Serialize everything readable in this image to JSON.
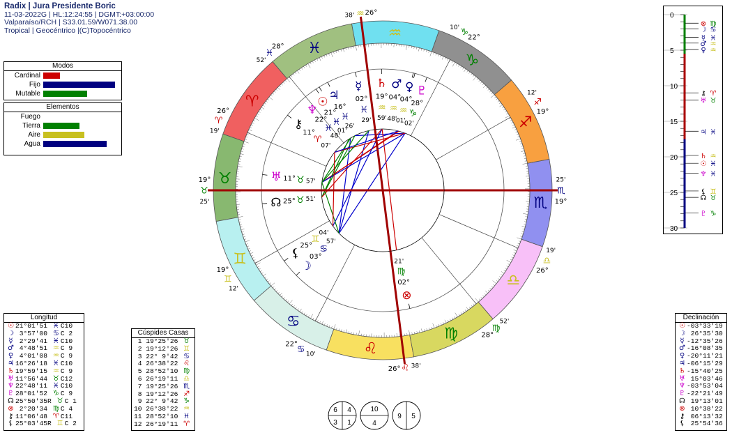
{
  "header": {
    "title": "Radix | Jura Presidente Boric",
    "line1": "11-03-2022G | HL:12:24:55 | DGMT:+03:00:00",
    "line2": "Valparaíso/RCH | S33.01.59/W071.38.00",
    "line3": "Tropical | Geocéntrico |(C)Topocéntrico"
  },
  "modos": {
    "title": "Modos",
    "rows": [
      {
        "label": "Cardinal",
        "value": 0.22,
        "color": "#cc0000"
      },
      {
        "label": "Fijo",
        "value": 0.95,
        "color": "#000080"
      },
      {
        "label": "Mutable",
        "value": 0.58,
        "color": "#008000"
      }
    ]
  },
  "elementos": {
    "title": "Elementos",
    "rows": [
      {
        "label": "Fuego",
        "value": 0.0,
        "color": "#cc0000"
      },
      {
        "label": "Tierra",
        "value": 0.48,
        "color": "#008000"
      },
      {
        "label": "Aire",
        "value": 0.55,
        "color": "#c8c020"
      },
      {
        "label": "Agua",
        "value": 0.84,
        "color": "#000080"
      }
    ]
  },
  "longitud": {
    "title": "Longitud",
    "rows": [
      {
        "g": "☉",
        "c": "#cc0000",
        "deg": "21°01'51",
        "s": "♓",
        "sc": "#000080",
        "h": "C10"
      },
      {
        "g": "☽",
        "c": "#000080",
        "deg": " 3°57'00",
        "s": "♋",
        "sc": "#000080",
        "h": "C 2"
      },
      {
        "g": "☿",
        "c": "#000080",
        "deg": " 2°29'41",
        "s": "♓",
        "sc": "#000080",
        "h": "C10"
      },
      {
        "g": "♂",
        "c": "#000080",
        "deg": " 4°48'51",
        "s": "♒",
        "sc": "#c8c020",
        "h": "C 9"
      },
      {
        "g": "♀",
        "c": "#000080",
        "deg": " 4°01'08",
        "s": "♒",
        "sc": "#c8c020",
        "h": "C 9"
      },
      {
        "g": "♃",
        "c": "#000080",
        "deg": "16°26'18",
        "s": "♓",
        "sc": "#000080",
        "h": "C10"
      },
      {
        "g": "♄",
        "c": "#cc0000",
        "deg": "19°59'15",
        "s": "♒",
        "sc": "#c8c020",
        "h": "C 9"
      },
      {
        "g": "♅",
        "c": "#cc00cc",
        "deg": "11°56'44",
        "s": "♉",
        "sc": "#008000",
        "h": "C12"
      },
      {
        "g": "♆",
        "c": "#cc00cc",
        "deg": "22°48'11",
        "s": "♓",
        "sc": "#000080",
        "h": "C10"
      },
      {
        "g": "♇",
        "c": "#cc00cc",
        "deg": "28°01'52",
        "s": "♑",
        "sc": "#008000",
        "h": "C 9"
      },
      {
        "g": "☊",
        "c": "#000000",
        "deg": "25°50'35R",
        "s": "♉",
        "sc": "#008000",
        "h": "C 1"
      },
      {
        "g": "⊗",
        "c": "#cc0000",
        "deg": " 2°20'34",
        "s": "♍",
        "sc": "#008000",
        "h": "C 4"
      },
      {
        "g": "⚷",
        "c": "#000000",
        "deg": "11°06'48",
        "s": "♈",
        "sc": "#cc0000",
        "h": "C11"
      },
      {
        "g": "⚸",
        "c": "#000000",
        "deg": "25°03'45R",
        "s": "♊",
        "sc": "#c8c020",
        "h": "C 2"
      }
    ]
  },
  "cuspides": {
    "title": "Cúspides Casas",
    "rows": [
      {
        "n": " 1",
        "deg": "19°25'26",
        "s": "♉",
        "sc": "#008000"
      },
      {
        "n": " 2",
        "deg": "19°12'26",
        "s": "♊",
        "sc": "#c8c020"
      },
      {
        "n": " 3",
        "deg": "22° 9'42",
        "s": "♋",
        "sc": "#000080"
      },
      {
        "n": " 4",
        "deg": "26°38'22",
        "s": "♌",
        "sc": "#cc0000"
      },
      {
        "n": " 5",
        "deg": "28°52'10",
        "s": "♍",
        "sc": "#008000"
      },
      {
        "n": " 6",
        "deg": "26°19'11",
        "s": "♎",
        "sc": "#c8c020"
      },
      {
        "n": " 7",
        "deg": "19°25'26",
        "s": "♏",
        "sc": "#000080"
      },
      {
        "n": " 8",
        "deg": "19°12'26",
        "s": "♐",
        "sc": "#cc0000"
      },
      {
        "n": " 9",
        "deg": "22° 9'42",
        "s": "♑",
        "sc": "#008000"
      },
      {
        "n": "10",
        "deg": "26°38'22",
        "s": "♒",
        "sc": "#c8c020"
      },
      {
        "n": "11",
        "deg": "28°52'10",
        "s": "♓",
        "sc": "#000080"
      },
      {
        "n": "12",
        "deg": "26°19'11",
        "s": "♈",
        "sc": "#cc0000"
      }
    ]
  },
  "declinacion": {
    "title": "Declinación",
    "rows": [
      {
        "g": "☉",
        "c": "#cc0000",
        "v": "-03°33'19"
      },
      {
        "g": "☽",
        "c": "#000080",
        "v": " 26°35'30"
      },
      {
        "g": "☿",
        "c": "#000080",
        "v": "-12°35'26"
      },
      {
        "g": "♂",
        "c": "#000080",
        "v": "-16°08'35"
      },
      {
        "g": "♀",
        "c": "#000080",
        "v": "-20°11'21"
      },
      {
        "g": "♃",
        "c": "#000080",
        "v": "-06°15'29"
      },
      {
        "g": "♄",
        "c": "#cc0000",
        "v": "-15°40'25"
      },
      {
        "g": "♅",
        "c": "#cc00cc",
        "v": " 15°03'46"
      },
      {
        "g": "♆",
        "c": "#cc00cc",
        "v": "-03°53'04"
      },
      {
        "g": "♇",
        "c": "#cc00cc",
        "v": "-22°21'49"
      },
      {
        "g": "☊",
        "c": "#000000",
        "v": " 19°13'01"
      },
      {
        "g": "⊗",
        "c": "#cc0000",
        "v": " 10°38'22"
      },
      {
        "g": "⚷",
        "c": "#000000",
        "v": " 06°13'32"
      },
      {
        "g": "⚸",
        "c": "#000000",
        "v": " 25°54'36"
      }
    ]
  },
  "decl_scale": {
    "ticks": [
      "0",
      "5",
      "10",
      "15",
      "20",
      "25",
      "30"
    ],
    "max": 30,
    "marks": [
      {
        "d": 1.2,
        "g": "⊗",
        "c": "#cc0000",
        "s": "♍",
        "sc": "#008000"
      },
      {
        "d": 2.0,
        "g": "☽",
        "c": "#000080",
        "s": "♋",
        "sc": "#000080"
      },
      {
        "d": 3.2,
        "g": "☿",
        "c": "#000080",
        "s": "♓",
        "sc": "#000080"
      },
      {
        "d": 4.0,
        "g": "♂",
        "c": "#000080",
        "s": "♒",
        "sc": "#c8c020"
      },
      {
        "d": 4.9,
        "g": "♀",
        "c": "#000080",
        "s": "♒",
        "sc": "#c8c020"
      },
      {
        "d": 11.0,
        "g": "⚷",
        "c": "#000000",
        "s": "♈",
        "sc": "#cc0000"
      },
      {
        "d": 12.0,
        "g": "♅",
        "c": "#cc00cc",
        "s": "♉",
        "sc": "#008000"
      },
      {
        "d": 16.4,
        "g": "♃",
        "c": "#000080",
        "s": "♓",
        "sc": "#000080"
      },
      {
        "d": 19.8,
        "g": "♄",
        "c": "#cc0000",
        "s": "♒",
        "sc": "#c8c020"
      },
      {
        "d": 20.9,
        "g": "☉",
        "c": "#cc0000",
        "s": "♓",
        "sc": "#000080"
      },
      {
        "d": 22.3,
        "g": "♆",
        "c": "#cc00cc",
        "s": "♓",
        "sc": "#000080"
      },
      {
        "d": 24.8,
        "g": "⚸",
        "c": "#000000",
        "s": "♊",
        "sc": "#c8c020"
      },
      {
        "d": 25.7,
        "g": "☊",
        "c": "#000000",
        "s": "♉",
        "sc": "#008000"
      },
      {
        "d": 27.9,
        "g": "♇",
        "c": "#cc00cc",
        "s": "♑",
        "sc": "#008000"
      }
    ]
  },
  "wheel": {
    "asc": 49.42,
    "sign_glyphs": [
      "♈",
      "♉",
      "♊",
      "♋",
      "♌",
      "♍",
      "♎",
      "♏",
      "♐",
      "♑",
      "♒",
      "♓"
    ],
    "sign_fill": [
      "#f06060",
      "#88b870",
      "#b8f0f0",
      "#d8f0e8",
      "#f8e060",
      "#d8d860",
      "#f8c0f8",
      "#9090f0",
      "#f8a040",
      "#909090",
      "#70e0f0",
      "#a0c080"
    ],
    "sign_glyph_color": [
      "#cc0000",
      "#008000",
      "#c8c020",
      "#000080",
      "#cc0000",
      "#008000",
      "#c8c020",
      "#000080",
      "#cc0000",
      "#008000",
      "#c8c020",
      "#000080"
    ],
    "cusps": [
      {
        "n": 1,
        "lon": 49.42,
        "deg": "19°",
        "sign": "♉",
        "min": "25'",
        "c": "#008000"
      },
      {
        "n": 2,
        "lon": 79.21,
        "deg": "19°",
        "sign": "♊",
        "min": "12'",
        "c": "#c8c020"
      },
      {
        "n": 3,
        "lon": 112.16,
        "deg": "22°",
        "sign": "♋",
        "min": "10'",
        "c": "#000080"
      },
      {
        "n": 4,
        "lon": 146.64,
        "deg": "26°",
        "sign": "♌",
        "min": "38'",
        "c": "#cc0000"
      },
      {
        "n": 5,
        "lon": 178.87,
        "deg": "28°",
        "sign": "♍",
        "min": "52'",
        "c": "#008000"
      },
      {
        "n": 6,
        "lon": 206.32,
        "deg": "26°",
        "sign": "♎",
        "min": "19'",
        "c": "#c8c020"
      },
      {
        "n": 7,
        "lon": 229.42,
        "deg": "19°",
        "sign": "♏",
        "min": "25'",
        "c": "#000080"
      },
      {
        "n": 8,
        "lon": 259.21,
        "deg": "19°",
        "sign": "♐",
        "min": "12'",
        "c": "#cc0000"
      },
      {
        "n": 9,
        "lon": 292.16,
        "deg": "22°",
        "sign": "♑",
        "min": "10'",
        "c": "#008000"
      },
      {
        "n": 10,
        "lon": 326.64,
        "deg": "26°",
        "sign": "♒",
        "min": "38'",
        "c": "#c8c020"
      },
      {
        "n": 11,
        "lon": 358.87,
        "deg": "28°",
        "sign": "♓",
        "min": "52'",
        "c": "#000080"
      },
      {
        "n": 12,
        "lon": 26.32,
        "deg": "26°",
        "sign": "♈",
        "min": "19'",
        "c": "#cc0000"
      }
    ],
    "planets": [
      {
        "g": "☉",
        "c": "#cc0000",
        "lon": 351.03,
        "deg": "21°",
        "s": "♓",
        "sc": "#000080",
        "min": "01'"
      },
      {
        "g": "☽",
        "c": "#000080",
        "lon": 93.95,
        "deg": "03°",
        "s": "♋",
        "sc": "#000080",
        "min": "57'"
      },
      {
        "g": "☿",
        "c": "#000080",
        "lon": 332.49,
        "deg": "02°",
        "s": "♓",
        "sc": "#000080",
        "min": "29'"
      },
      {
        "g": "♂",
        "c": "#000080",
        "lon": 304.81,
        "deg": "04°",
        "s": "♒",
        "sc": "#c8c020",
        "min": "48'"
      },
      {
        "g": "♀",
        "c": "#000080",
        "lon": 304.02,
        "deg": "04°",
        "s": "♒",
        "sc": "#c8c020",
        "min": "01'"
      },
      {
        "g": "♃",
        "c": "#000080",
        "lon": 346.44,
        "deg": "16°",
        "s": "♓",
        "sc": "#000080",
        "min": "26'"
      },
      {
        "g": "♄",
        "c": "#cc0000",
        "lon": 319.99,
        "deg": "19°",
        "s": "♒",
        "sc": "#c8c020",
        "min": "59'"
      },
      {
        "g": "♅",
        "c": "#cc00cc",
        "lon": 41.95,
        "deg": "11°",
        "s": "♉",
        "sc": "#008000",
        "min": "57'"
      },
      {
        "g": "♆",
        "c": "#cc00cc",
        "lon": 352.8,
        "deg": "22°",
        "s": "♓",
        "sc": "#000080",
        "min": "48'"
      },
      {
        "g": "♇",
        "c": "#cc00cc",
        "lon": 298.03,
        "deg": "28°",
        "s": "♑",
        "sc": "#008000",
        "min": "02'"
      },
      {
        "g": "☊",
        "c": "#000000",
        "lon": 55.84,
        "deg": "25°",
        "s": "♉",
        "sc": "#008000",
        "min": "51'"
      },
      {
        "g": "⊗",
        "c": "#cc0000",
        "lon": 152.34,
        "deg": "02°",
        "s": "♍",
        "sc": "#008000",
        "min": "21'"
      },
      {
        "g": "⚷",
        "c": "#000000",
        "lon": 11.11,
        "deg": "11°",
        "s": "♈",
        "sc": "#cc0000",
        "min": "07'"
      },
      {
        "g": "⚸",
        "c": "#000000",
        "lon": 85.06,
        "deg": "25°",
        "s": "♊",
        "sc": "#c8c020",
        "min": "04'"
      }
    ],
    "aspects": [
      {
        "a": 351.03,
        "b": 93.95,
        "c": "#0000cc"
      },
      {
        "a": 332.49,
        "b": 93.95,
        "c": "#0000cc"
      },
      {
        "a": 304.81,
        "b": 41.95,
        "c": "#cc0000"
      },
      {
        "a": 304.02,
        "b": 41.95,
        "c": "#cc0000"
      },
      {
        "a": 346.44,
        "b": 298.03,
        "c": "#0000cc"
      },
      {
        "a": 351.03,
        "b": 41.95,
        "c": "#008000"
      },
      {
        "a": 352.8,
        "b": 55.84,
        "c": "#008000"
      },
      {
        "a": 346.44,
        "b": 55.84,
        "c": "#008000"
      },
      {
        "a": 319.99,
        "b": 55.84,
        "c": "#cc0000"
      },
      {
        "a": 298.03,
        "b": 41.95,
        "c": "#0000cc"
      },
      {
        "a": 93.95,
        "b": 298.03,
        "c": "#0000cc"
      },
      {
        "a": 319.99,
        "b": 85.06,
        "c": "#0000cc"
      },
      {
        "a": 11.11,
        "b": 298.03,
        "c": "#cc0000"
      },
      {
        "a": 304.81,
        "b": 11.11,
        "c": "#0000cc"
      },
      {
        "a": 332.49,
        "b": 41.95,
        "c": "#008000"
      },
      {
        "a": 152.34,
        "b": 319.99,
        "c": "#cc0000"
      },
      {
        "a": 93.95,
        "b": 41.95,
        "c": "#008000"
      },
      {
        "a": 85.06,
        "b": 11.11,
        "c": "#cc0000"
      }
    ]
  },
  "house_dial": {
    "a": [
      "6",
      "4",
      "3",
      "1"
    ],
    "b": [
      "10",
      "4"
    ],
    "c": [
      "9",
      "5"
    ]
  }
}
